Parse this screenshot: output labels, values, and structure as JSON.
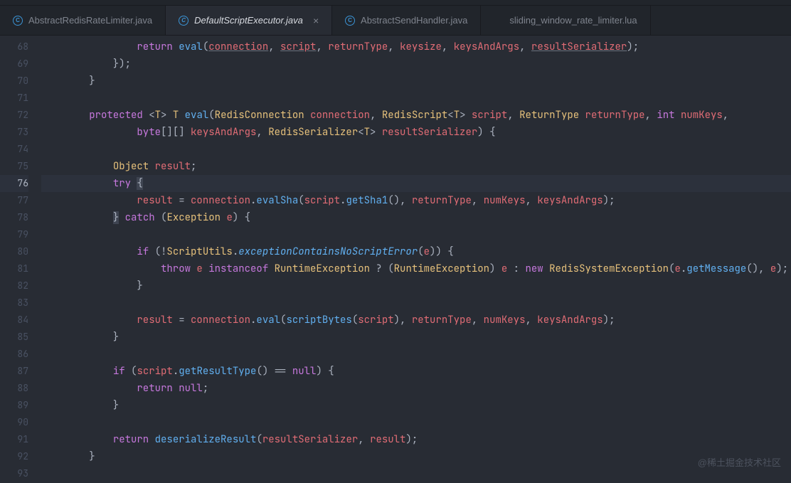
{
  "tabs": [
    {
      "label": "AbstractRedisRateLimiter.java",
      "icon": "java",
      "active": false
    },
    {
      "label": "DefaultScriptExecutor.java",
      "icon": "java",
      "active": true
    },
    {
      "label": "AbstractSendHandler.java",
      "icon": "java",
      "active": false
    },
    {
      "label": "sliding_window_rate_limiter.lua",
      "icon": "lua",
      "active": false
    }
  ],
  "line_start": 68,
  "line_end": 93,
  "current_line": 76,
  "tokens": {
    "protected": "protected",
    "try": "try",
    "catch": "catch",
    "throw": "throw",
    "instanceof": "instanceof",
    "new": "new",
    "if": "if",
    "return": "return",
    "int": "int",
    "byte": "byte",
    "null": "null",
    "RedisConnection": "RedisConnection",
    "RedisScript": "RedisScript",
    "ReturnType": "ReturnType",
    "RedisSerializer": "RedisSerializer",
    "Object": "Object",
    "Exception": "Exception",
    "RuntimeException": "RuntimeException",
    "RedisSystemException": "RedisSystemException",
    "ScriptUtils": "ScriptUtils",
    "T": "T",
    "eval": "eval",
    "evalSha": "evalSha",
    "getSha1": "getSha1",
    "getMessage": "getMessage",
    "getResultType": "getResultType",
    "deserializeResult": "deserializeResult",
    "scriptBytes": "scriptBytes",
    "exceptionContainsNoScriptError": "exceptionContainsNoScriptError",
    "connection": "connection",
    "script": "script",
    "returnType": "returnType",
    "numKeys": "numKeys",
    "keysAndArgs": "keysAndArgs",
    "resultSerializer": "resultSerializer",
    "result": "result",
    "e": "e",
    "resultSerializer2": "resultSerializer",
    "keysize": "keysize"
  },
  "watermark": "@稀土掘金技术社区"
}
